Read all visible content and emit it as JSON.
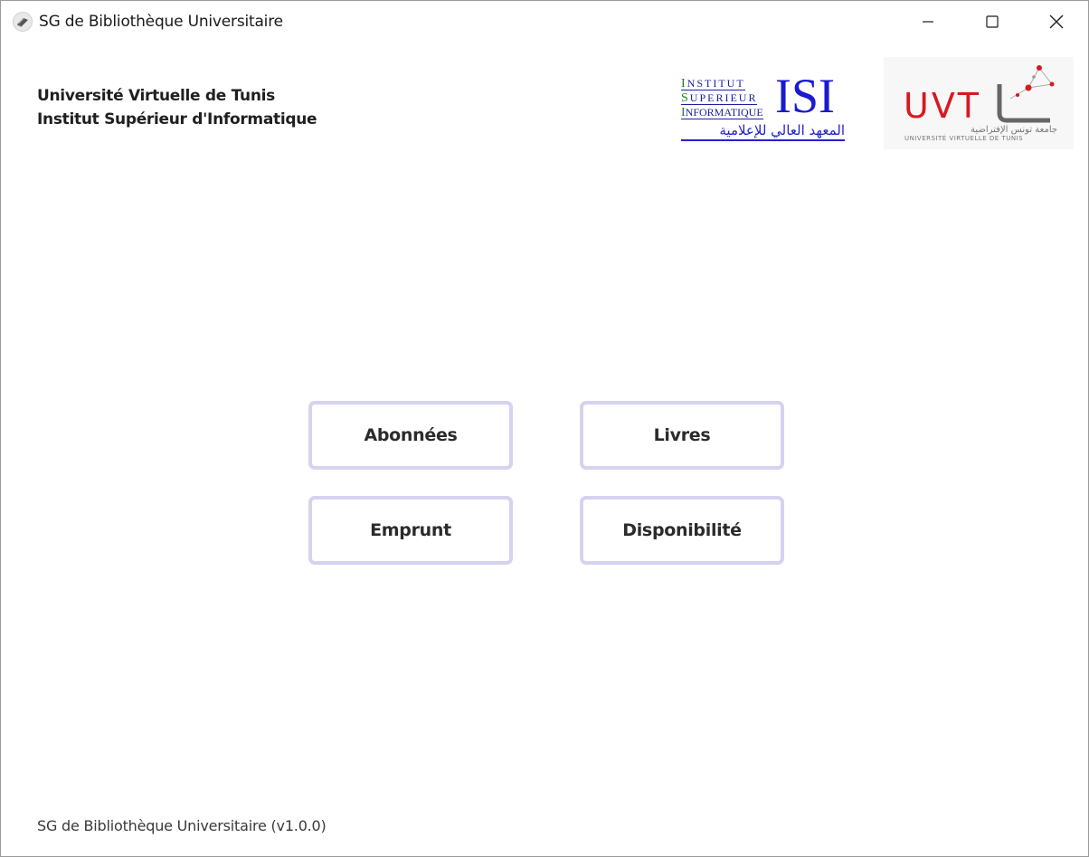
{
  "window": {
    "title": "SG de Bibliothèque Universitaire",
    "app_icon": "book-icon"
  },
  "controls": {
    "minimize_icon": "minimize-icon",
    "maximize_icon": "maximize-icon",
    "close_icon": "close-icon"
  },
  "header": {
    "line1": "Université Virtuelle de Tunis",
    "line2": "Institut Supérieur d'Informatique"
  },
  "isi_logo": {
    "row1": "INSTITUT",
    "row2": "SUPERIEUR",
    "row3": "INFORMATIQUE",
    "big": "ISI",
    "arabic": "المعهد العالي للإعلامية"
  },
  "uvt_logo": {
    "text": "UVT",
    "arabic": "جامعة تونس الإفتراضية",
    "subtitle": "UNIVERSITÉ VIRTUELLE DE TUNIS"
  },
  "menu": {
    "abonnees": "Abonnées",
    "livres": "Livres",
    "emprunt": "Emprunt",
    "disponibilite": "Disponibilité"
  },
  "footer": {
    "text": "SG de Bibliothèque Universitaire (v1.0.0)"
  },
  "colors": {
    "button_border": "#d5d3f0",
    "isi_blue": "#1a1ad0",
    "isi_green": "#1b8a1b",
    "uvt_red": "#d8191f"
  }
}
